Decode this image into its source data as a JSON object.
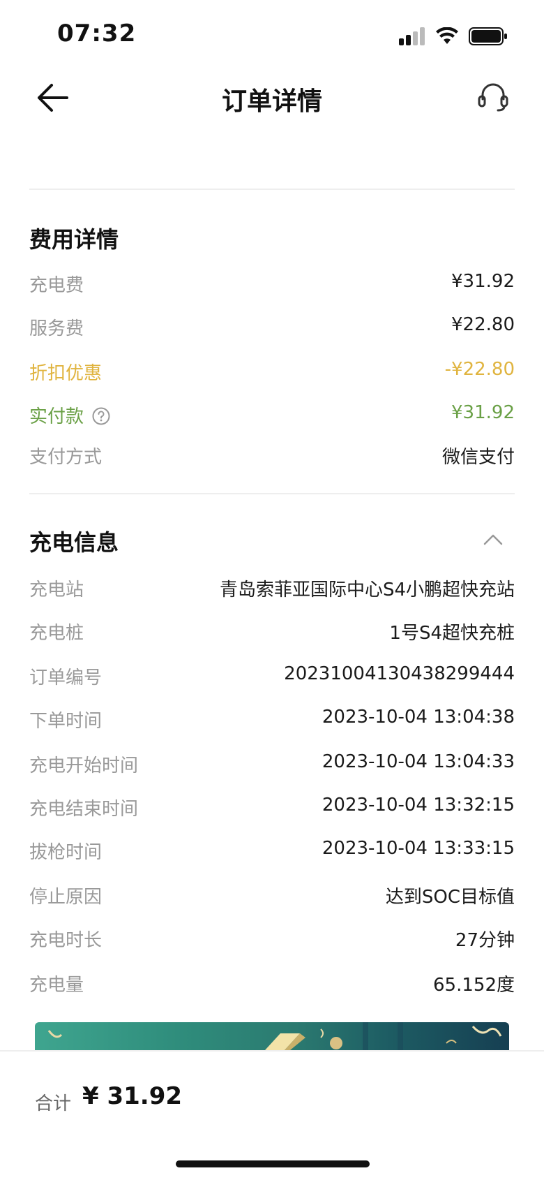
{
  "status_bar": {
    "time": "07:32"
  },
  "header": {
    "title": "订单详情",
    "back_icon": "arrow-left-icon",
    "support_icon": "headset-icon"
  },
  "fee_section": {
    "title": "费用详情",
    "rows": [
      {
        "label": "充电费",
        "value": "¥31.92"
      },
      {
        "label": "服务费",
        "value": "¥22.80"
      },
      {
        "label": "折扣优惠",
        "value": "-¥22.80"
      },
      {
        "label": "实付款",
        "value": "¥31.92"
      },
      {
        "label": "支付方式",
        "value": "微信支付"
      }
    ]
  },
  "charge_section": {
    "title": "充电信息",
    "rows": [
      {
        "label": "充电站",
        "value": "青岛索菲亚国际中心S4小鹏超快充站"
      },
      {
        "label": "充电桩",
        "value": "1号S4超快充桩"
      },
      {
        "label": "订单编号",
        "value": "20231004130438299444"
      },
      {
        "label": "下单时间",
        "value": "2023-10-04 13:04:38"
      },
      {
        "label": "充电开始时间",
        "value": "2023-10-04 13:04:33"
      },
      {
        "label": "充电结束时间",
        "value": "2023-10-04 13:32:15"
      },
      {
        "label": "拔枪时间",
        "value": "2023-10-04 13:33:15"
      },
      {
        "label": "停止原因",
        "value": "达到SOC目标值"
      },
      {
        "label": "充电时长",
        "value": "27分钟"
      },
      {
        "label": "充电量",
        "value": "65.152度"
      }
    ]
  },
  "bottom_bar": {
    "total_label": "合计",
    "total_value": "¥ 31.92"
  },
  "colors": {
    "discount": "#e0b43f",
    "paid": "#6aa046",
    "label_gray": "#999999"
  }
}
